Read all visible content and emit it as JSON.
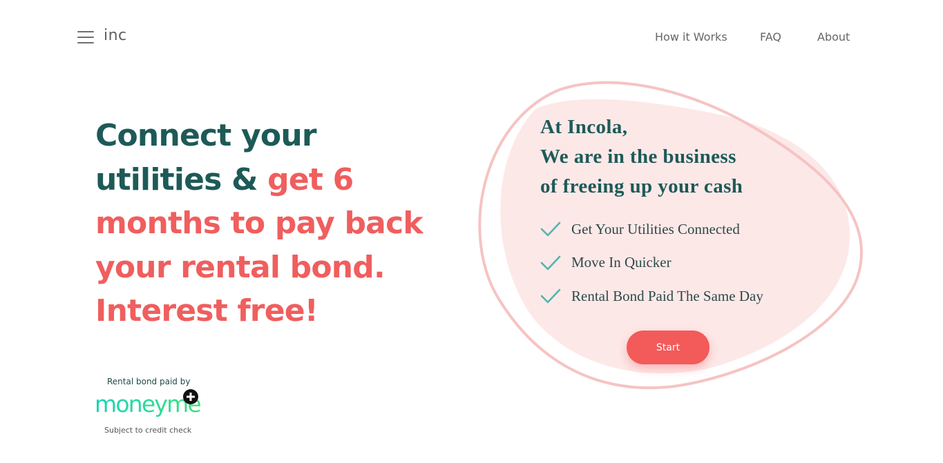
{
  "header": {
    "logo": "inc",
    "menu_icon": "hamburger-menu-icon",
    "nav": [
      {
        "label": "How it Works"
      },
      {
        "label": "FAQ"
      },
      {
        "label": "About"
      }
    ]
  },
  "hero": {
    "headline_dark_1": "Connect your",
    "headline_dark_2": "utilities & ",
    "headline_red_1": "get 6",
    "headline_red_2": "months to pay back",
    "headline_red_3": "your rental bond.",
    "headline_red_4": "Interest free!"
  },
  "partner": {
    "paid_by": "Rental bond paid by",
    "brand": "moneyme",
    "brand_icon": "plus-icon",
    "note": "Subject to credit check"
  },
  "card": {
    "tagline_1": "At Incola,",
    "tagline_2": "We are in the business",
    "tagline_3": "of freeing up your cash",
    "features": [
      {
        "label": "Get Your Utilities Connected",
        "icon": "check-icon"
      },
      {
        "label": "Move In Quicker",
        "icon": "check-icon"
      },
      {
        "label": "Rental Bond Paid The Same Day",
        "icon": "check-icon"
      }
    ],
    "cta_label": "Start"
  },
  "colors": {
    "dark_teal": "#1d5a57",
    "coral": "#f05e5e",
    "blob_fill": "#fde8e8",
    "blob_stroke": "#f6c3c3",
    "check": "#4fb6ad",
    "button": "#f35a5a"
  }
}
